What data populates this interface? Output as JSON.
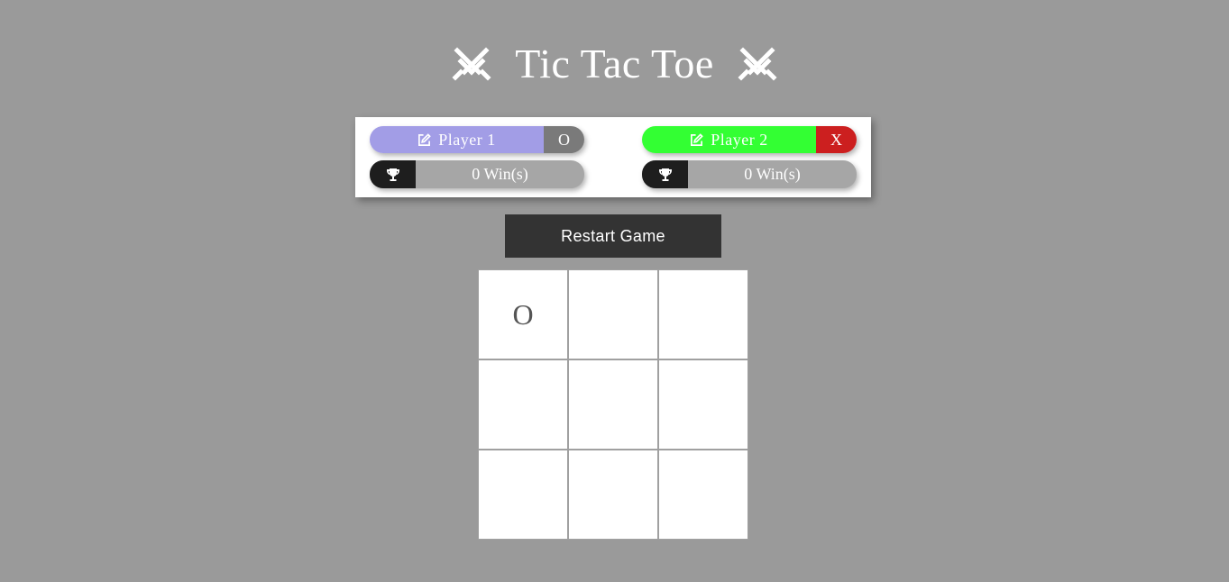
{
  "header": {
    "title": "Tic Tac Toe",
    "left_icon": "swords-icon",
    "right_icon": "swords-icon"
  },
  "players": [
    {
      "name": "Player 1",
      "mark": "O",
      "wins": "0 Win(s)",
      "name_color": "#a29de6",
      "mark_color": "#7a7a7a",
      "edit_icon": "edit-icon",
      "trophy_icon": "trophy-icon"
    },
    {
      "name": "Player 2",
      "mark": "X",
      "wins": "0 Win(s)",
      "name_color": "#33ff33",
      "mark_color": "#cc1f1f",
      "edit_icon": "edit-icon",
      "trophy_icon": "trophy-icon"
    }
  ],
  "controls": {
    "restart_label": "Restart Game"
  },
  "board": {
    "cells": [
      "O",
      "",
      "",
      "",
      "",
      "",
      "",
      "",
      ""
    ]
  },
  "colors": {
    "background": "#9a9a9a",
    "restart_button": "#333333",
    "trophy_bg": "#1e1e1e"
  }
}
